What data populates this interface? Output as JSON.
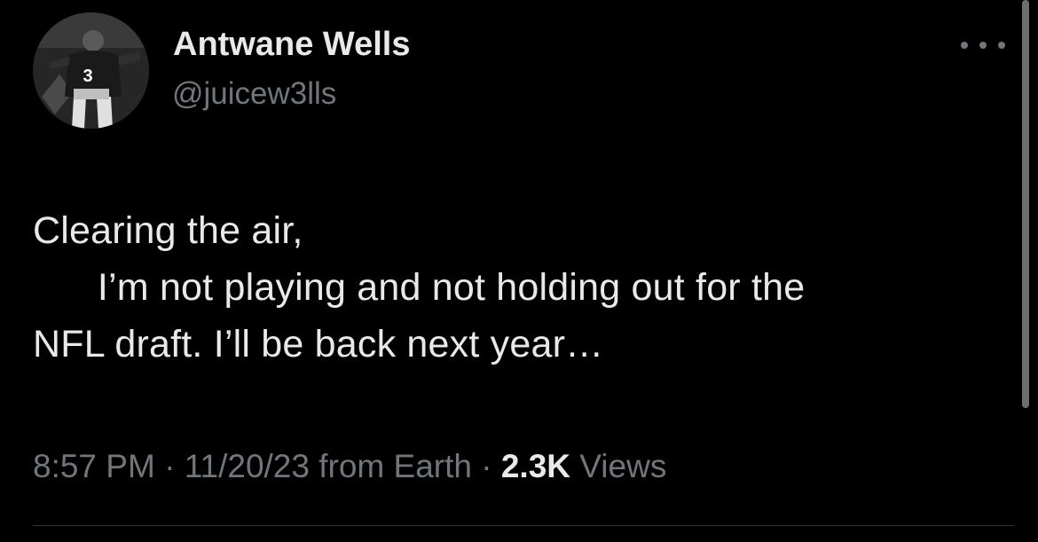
{
  "author": {
    "name": "Antwane Wells",
    "handle": "@juicew3lls",
    "avatar_icon": "profile-photo",
    "avatar_jersey_number": "3"
  },
  "more_icon": "more-horizontal-icon",
  "tweet": {
    "lines": [
      "Clearing the air,",
      "      I’m not playing and not holding out for the",
      "NFL draft. I’ll be back next year…"
    ]
  },
  "meta": {
    "time": "8:57 PM",
    "separator": "·",
    "date": "11/20/23",
    "source": "from Earth",
    "views_count": "2.3K",
    "views_label": "Views"
  },
  "colors": {
    "background": "#000000",
    "primary_text": "#e7e9ea",
    "secondary_text": "#71767b",
    "divider": "#2f3336"
  }
}
